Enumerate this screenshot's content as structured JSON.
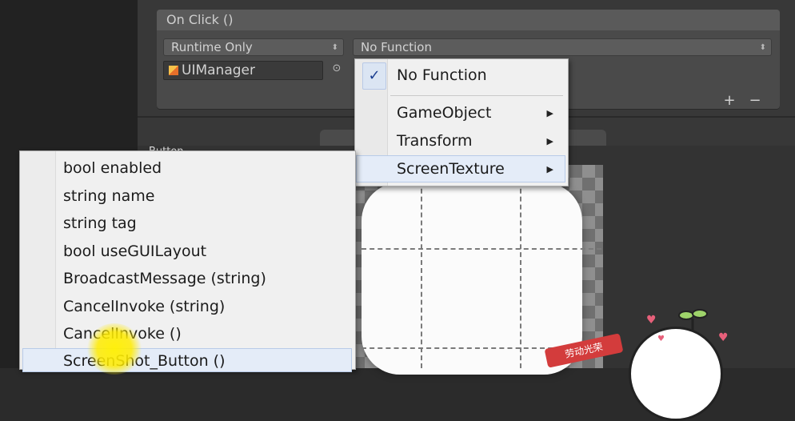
{
  "colors": {
    "panel": "#383838",
    "menu_background": "#f0f0f0",
    "menu_highlight": "#e4ecf8",
    "cursor_highlight": "#ffeb00"
  },
  "event": {
    "header": "On Click ()",
    "runtime_dropdown": "Runtime Only",
    "function_dropdown": "No Function",
    "object_field": "UIManager",
    "object_icon": "cube-icon",
    "picker_icon": "target-icon",
    "add_label": "+",
    "remove_label": "−"
  },
  "component_label": "Button",
  "function_menu": {
    "checked_item": "No Function",
    "check_mark": "✓",
    "items": [
      "GameObject",
      "Transform",
      "ScreenTexture"
    ],
    "submenu_arrow": "▶",
    "highlighted": "ScreenTexture"
  },
  "sub_menu": {
    "items": [
      "bool enabled",
      "string name",
      "string tag",
      "bool useGUILayout",
      "BroadcastMessage (string)",
      "CancelInvoke (string)",
      "CancelInvoke ()",
      "ScreenShot_Button ()"
    ],
    "highlighted": "ScreenShot_Button ()"
  },
  "sticker": {
    "banner_text": "劳动光荣"
  }
}
